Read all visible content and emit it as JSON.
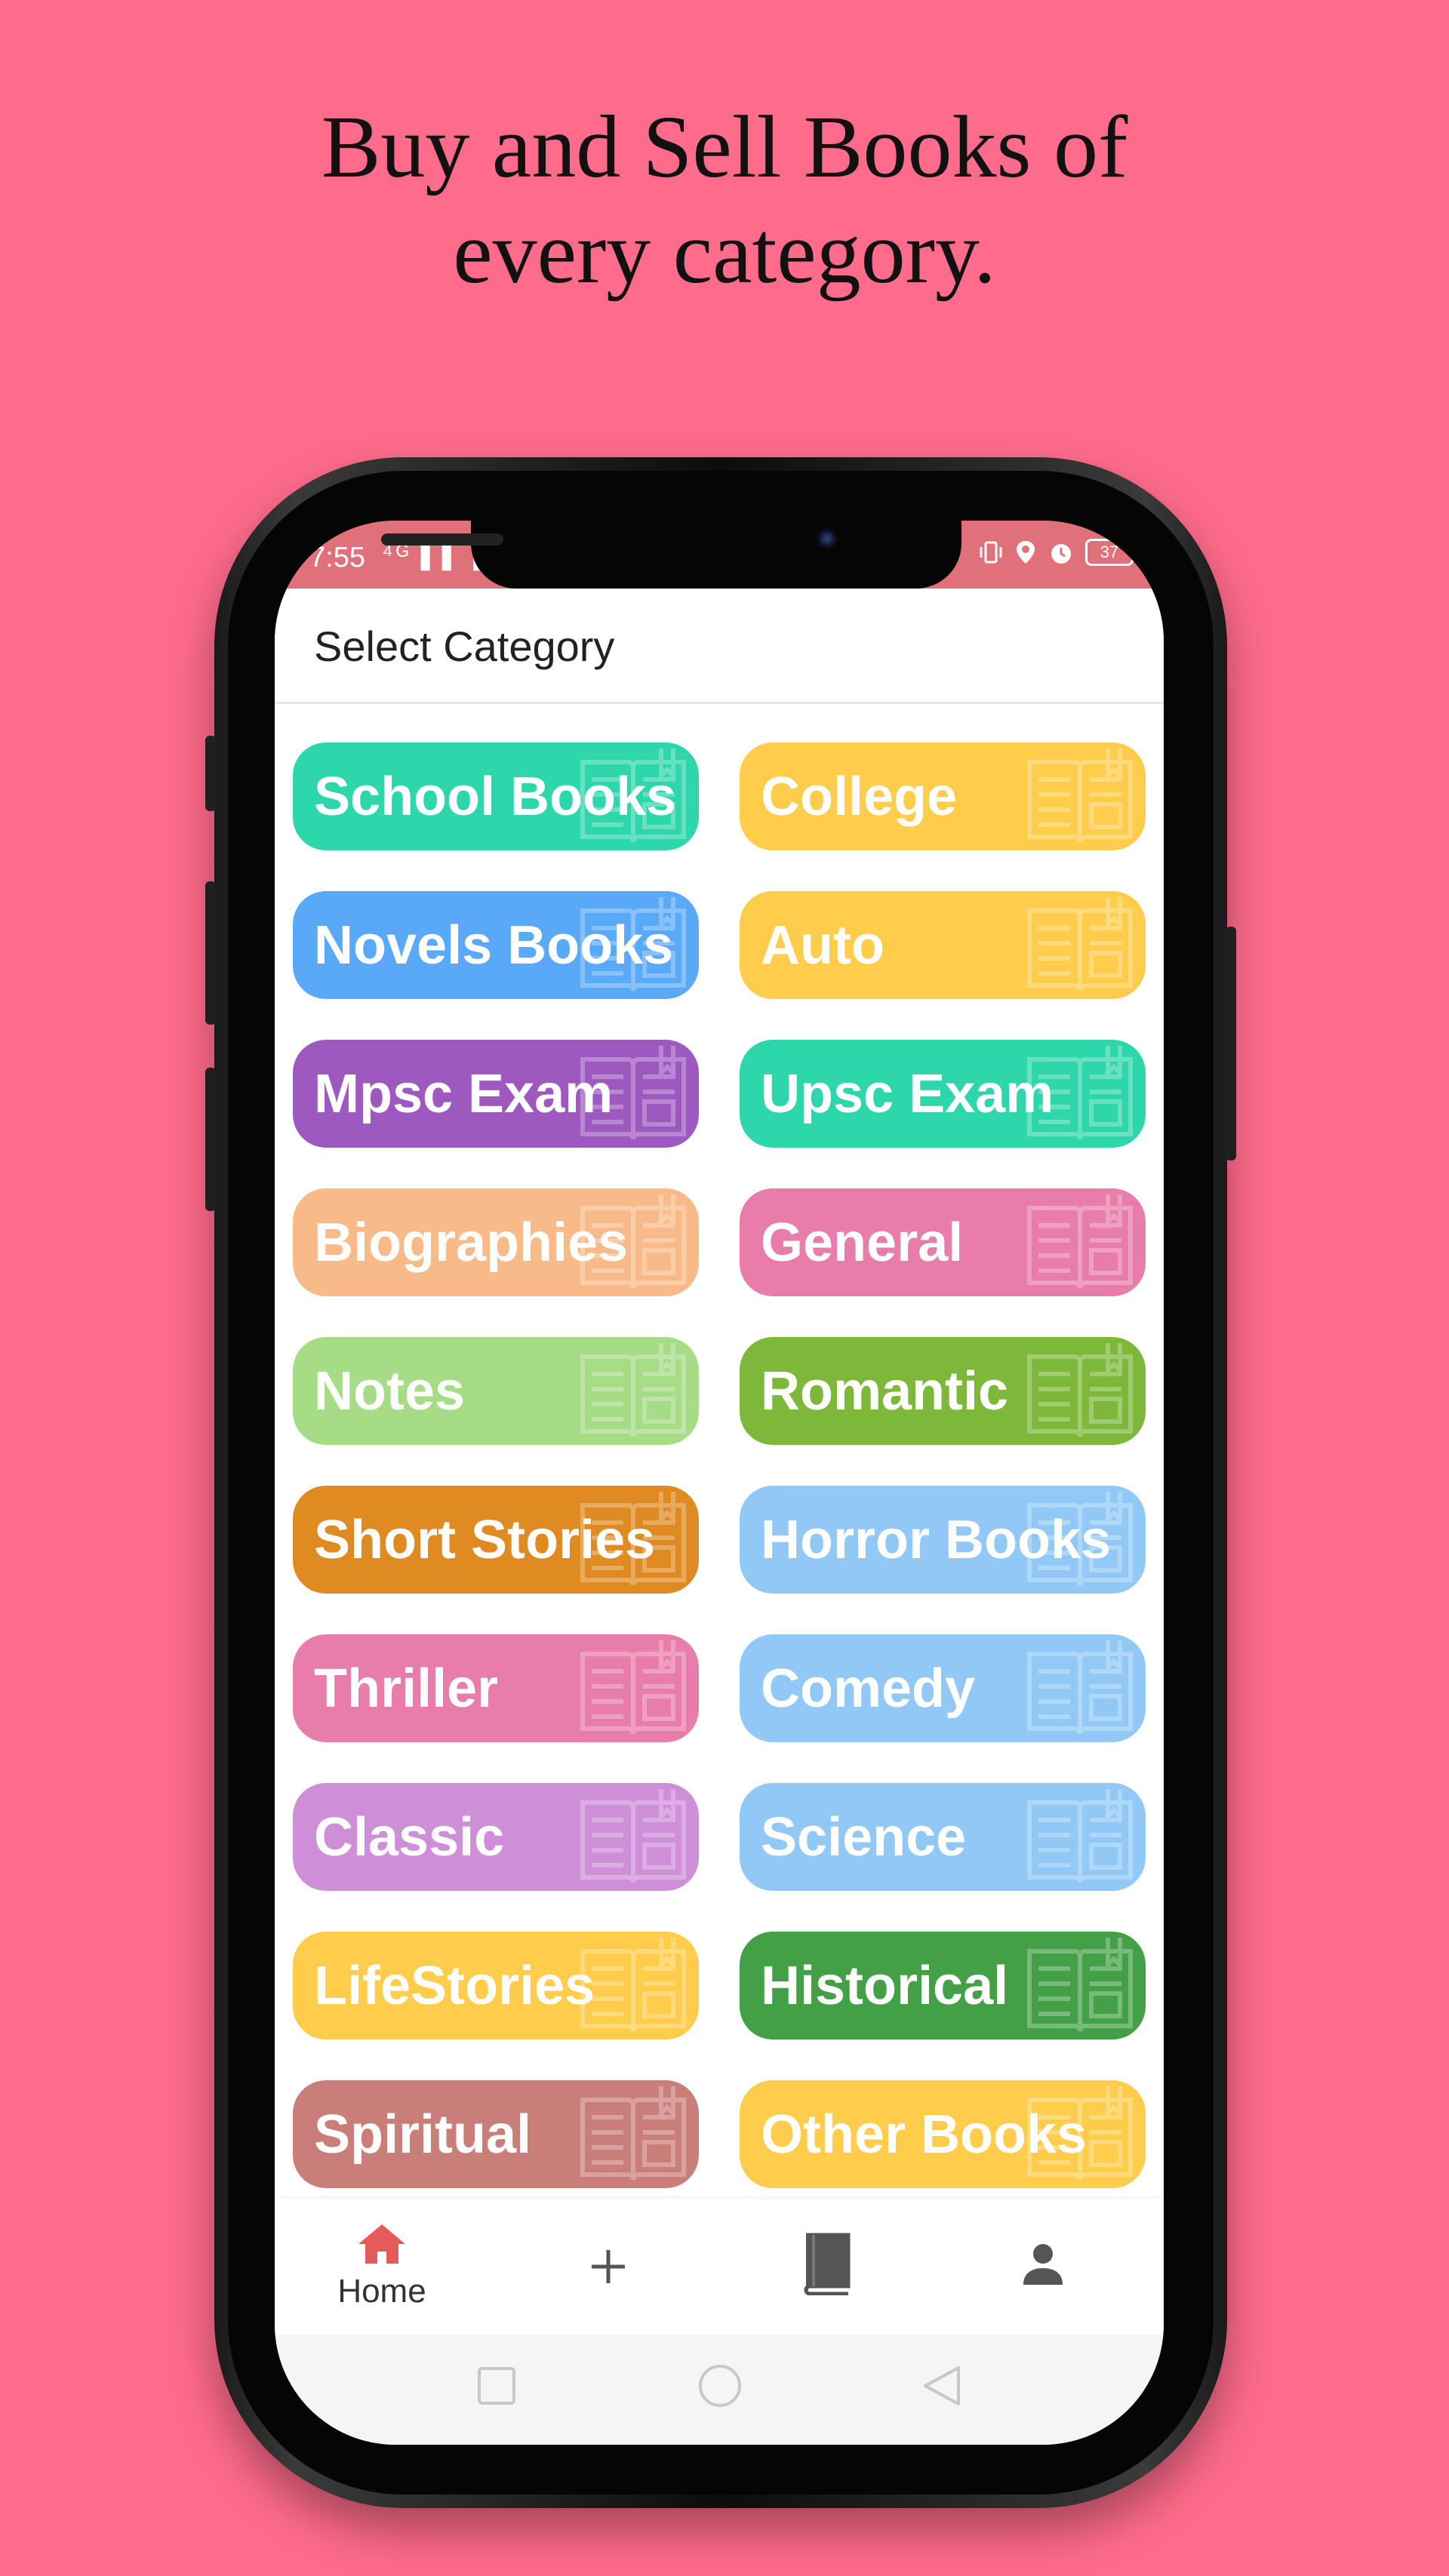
{
  "headline": {
    "line1": "Buy and Sell Books of",
    "line2": "every category."
  },
  "status_bar": {
    "time": "7:55",
    "left_icons": "⁴ᴳ▐▐ ▐▐",
    "battery": "37"
  },
  "app_bar": {
    "title": "Select Category"
  },
  "categories": [
    {
      "label": "School Books",
      "color": "#2ED6AB"
    },
    {
      "label": "College",
      "color": "#FFCD4B"
    },
    {
      "label": "Novels Books",
      "color": "#5AA9F8"
    },
    {
      "label": "Auto",
      "color": "#FFCD4B"
    },
    {
      "label": "Mpsc Exam",
      "color": "#9D59C0"
    },
    {
      "label": "Upsc Exam",
      "color": "#2ED6AB"
    },
    {
      "label": "Biographies",
      "color": "#F8BA88"
    },
    {
      "label": "General",
      "color": "#E87CAB"
    },
    {
      "label": "Notes",
      "color": "#A5DC85"
    },
    {
      "label": "Romantic",
      "color": "#7DB83A"
    },
    {
      "label": "Short Stories",
      "color": "#E08A22"
    },
    {
      "label": "Horror Books",
      "color": "#91C8F5"
    },
    {
      "label": "Thriller",
      "color": "#E87CAB"
    },
    {
      "label": "Comedy",
      "color": "#91C8F5"
    },
    {
      "label": "Classic",
      "color": "#CE8FD8"
    },
    {
      "label": "Science",
      "color": "#91C8F5"
    },
    {
      "label": "LifeStories",
      "color": "#FFCD4B"
    },
    {
      "label": "Historical",
      "color": "#43A047"
    },
    {
      "label": "Spiritual",
      "color": "#C97E7A"
    },
    {
      "label": "Other Books",
      "color": "#FFCD4B"
    }
  ],
  "bottom_nav": {
    "home_label": "Home",
    "active_color": "#E55A5A",
    "icons": [
      "home-icon",
      "add-icon",
      "book-icon",
      "profile-icon"
    ]
  },
  "system_nav": {
    "icons": [
      "recents-icon",
      "home-circle-icon",
      "back-icon"
    ]
  }
}
